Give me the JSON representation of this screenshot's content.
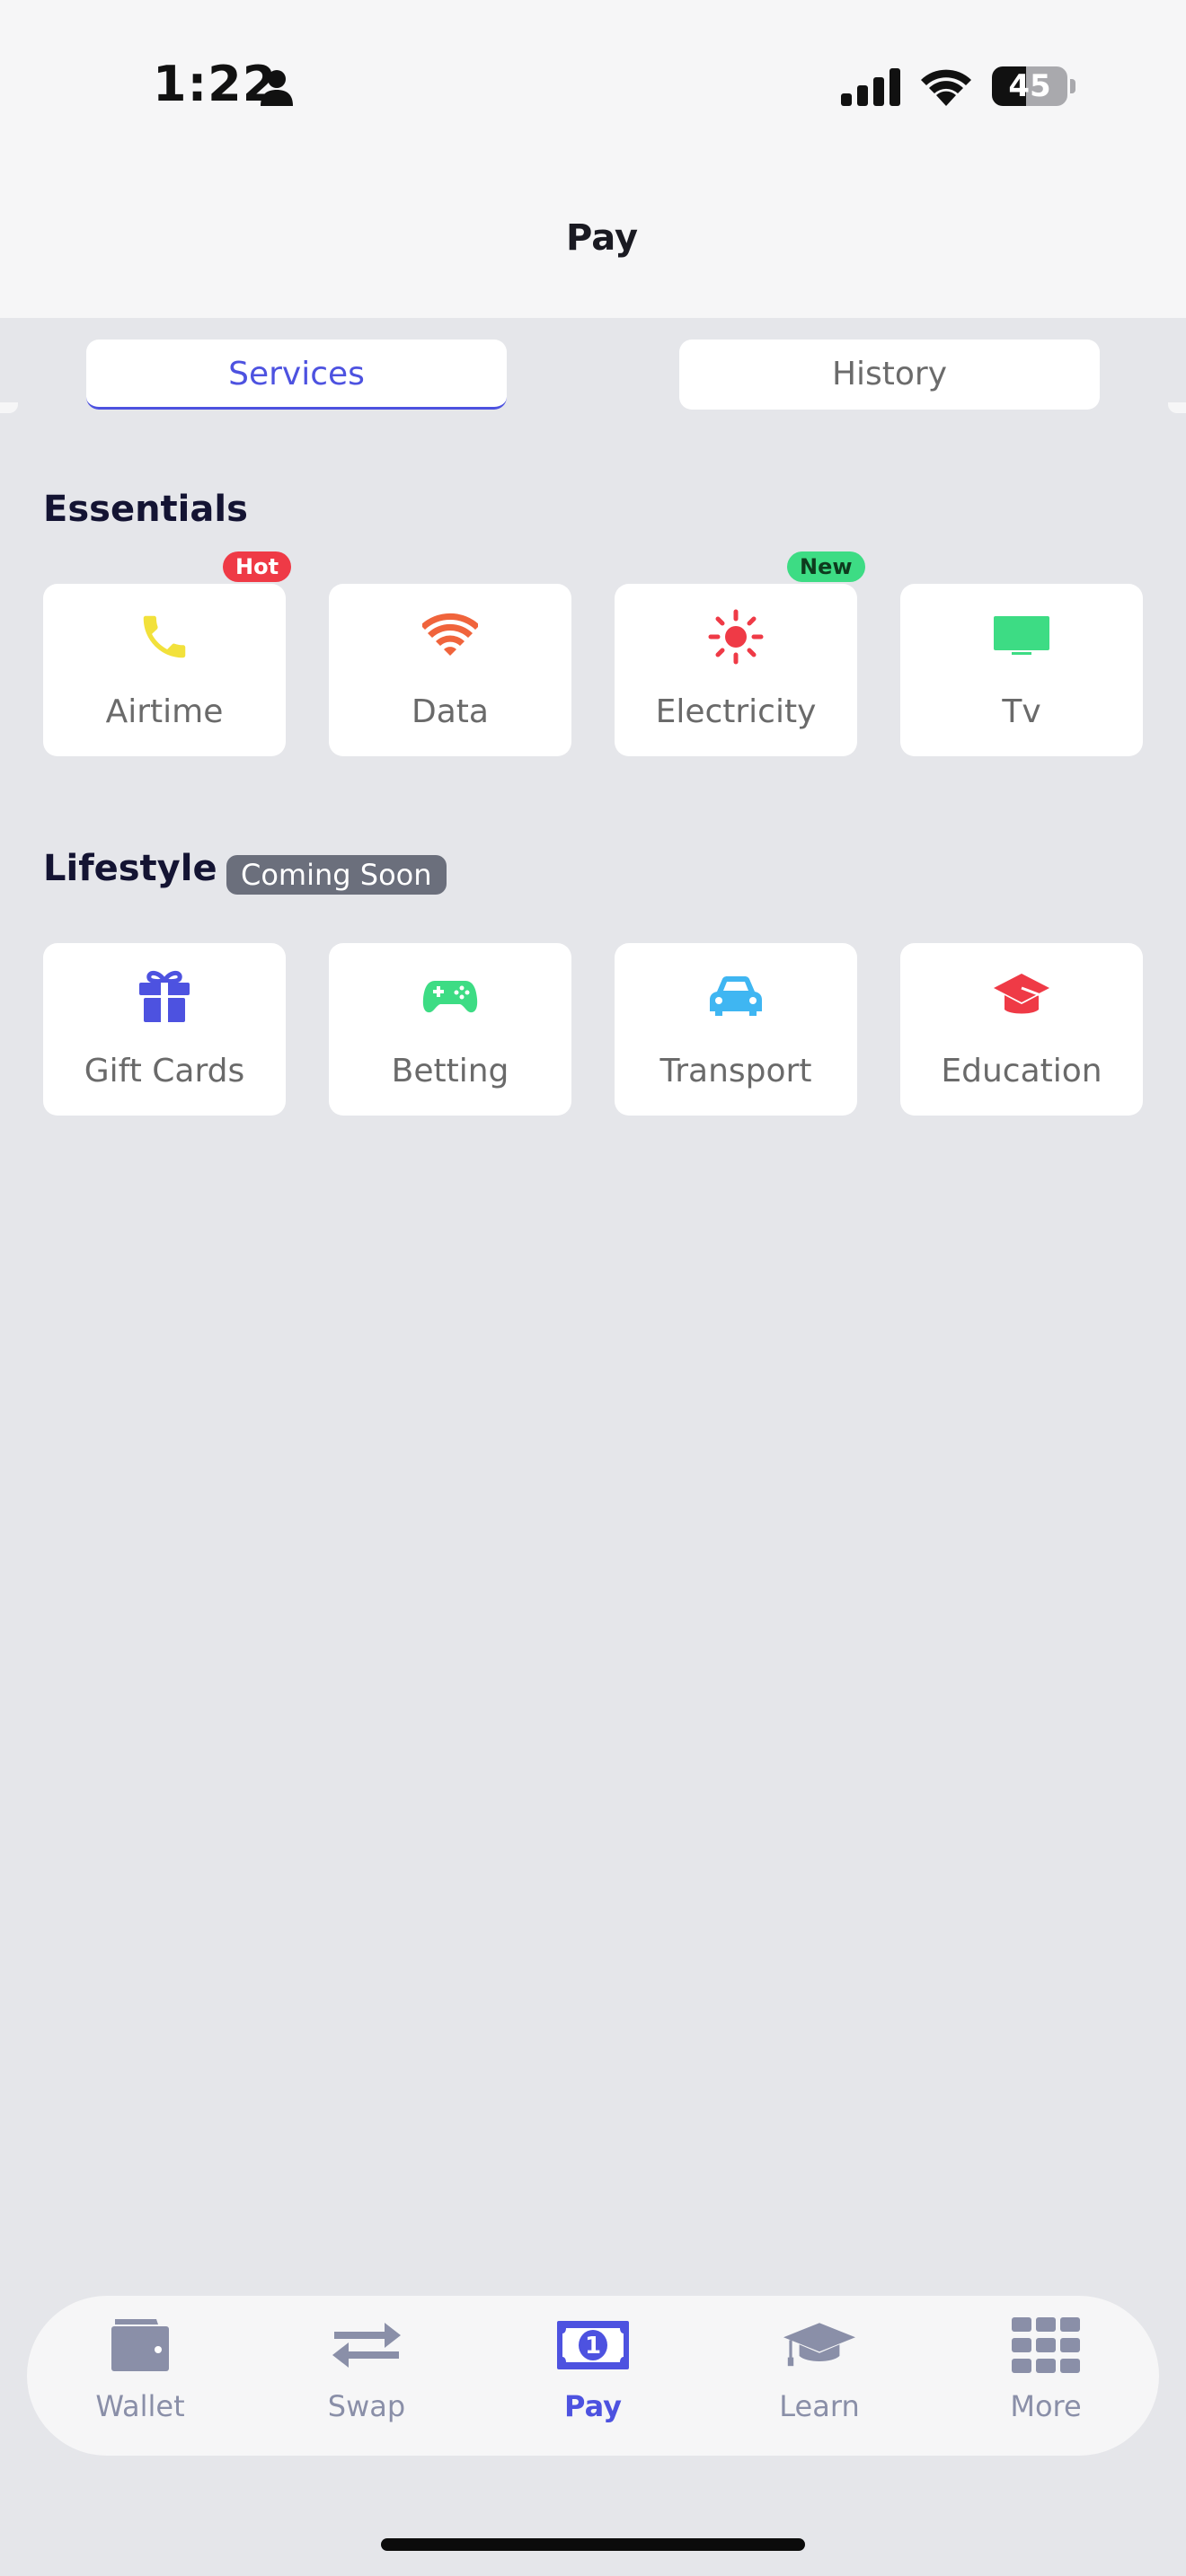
{
  "status_bar": {
    "time": "1:22",
    "battery": "45"
  },
  "header": {
    "title": "Pay"
  },
  "tabs": [
    {
      "label": "Services",
      "active": true
    },
    {
      "label": "History",
      "active": false
    }
  ],
  "essentials": {
    "title": "Essentials",
    "items": [
      {
        "label": "Airtime",
        "icon": "phone-icon",
        "color": "#f2e13b",
        "badge": "Hot"
      },
      {
        "label": "Data",
        "icon": "wifi-icon",
        "color": "#f0643c",
        "badge": ""
      },
      {
        "label": "Electricity",
        "icon": "sun-icon",
        "color": "#ef3a46",
        "badge": "New"
      },
      {
        "label": "Tv",
        "icon": "tv-icon",
        "color": "#3ddc84",
        "badge": ""
      }
    ]
  },
  "lifestyle": {
    "title": "Lifestyle",
    "tag": "Coming Soon",
    "items": [
      {
        "label": "Gift Cards",
        "icon": "gift-icon",
        "color": "#4d52e0"
      },
      {
        "label": "Betting",
        "icon": "gamepad-icon",
        "color": "#3ddc84"
      },
      {
        "label": "Transport",
        "icon": "car-icon",
        "color": "#3fb6f2"
      },
      {
        "label": "Education",
        "icon": "graduation-cap-icon",
        "color": "#ef3a46"
      }
    ]
  },
  "bottom_nav": [
    {
      "label": "Wallet",
      "icon": "wallet-icon",
      "active": false
    },
    {
      "label": "Swap",
      "icon": "swap-arrows-icon",
      "active": false
    },
    {
      "label": "Pay",
      "icon": "banknote-icon",
      "active": true
    },
    {
      "label": "Learn",
      "icon": "graduation-cap-icon",
      "active": false
    },
    {
      "label": "More",
      "icon": "grid-icon",
      "active": false
    }
  ],
  "colors": {
    "accent": "#4d52e0",
    "nav_inactive": "#8a8fa8",
    "hot_badge": "#ef3a46",
    "new_badge": "#3ddc84"
  }
}
